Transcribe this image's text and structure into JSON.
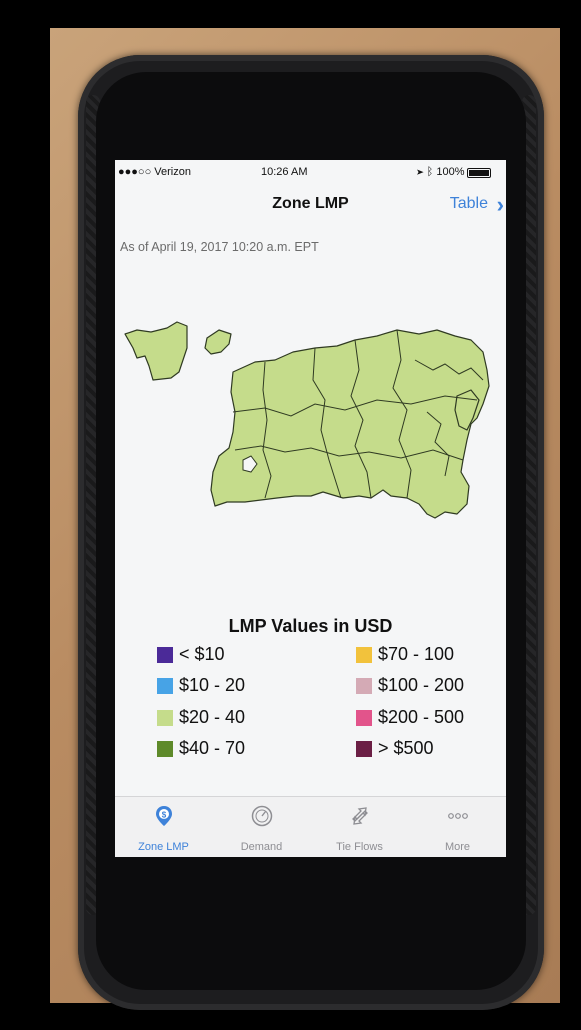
{
  "status_bar": {
    "carrier": "●●●○○ Verizon",
    "time": "10:26 AM",
    "battery": "100%"
  },
  "nav": {
    "title": "Zone LMP",
    "table_link": "Table"
  },
  "as_of": "As of April 19, 2017 10:20 a.m. EPT",
  "map": {
    "fill_color": "#c5dc8b"
  },
  "legend": {
    "title": "LMP Values in USD",
    "items": [
      {
        "label": "< $10",
        "color": "#4b2a98"
      },
      {
        "label": "$10 - 20",
        "color": "#47a3e6"
      },
      {
        "label": "$20 - 40",
        "color": "#c5dc8b"
      },
      {
        "label": "$40 - 70",
        "color": "#5e8a2a"
      },
      {
        "label": "$70 - 100",
        "color": "#f2c23c"
      },
      {
        "label": "$100 - 200",
        "color": "#d4aab5"
      },
      {
        "label": "$200 - 500",
        "color": "#e2548b"
      },
      {
        "label": "> $500",
        "color": "#6b1f45"
      }
    ]
  },
  "tabs": [
    {
      "label": "Zone LMP",
      "icon": "dollar-pin-icon",
      "active": true
    },
    {
      "label": "Demand",
      "icon": "gauge-icon",
      "active": false
    },
    {
      "label": "Tie Flows",
      "icon": "exchange-arrows-icon",
      "active": false
    },
    {
      "label": "More",
      "icon": "more-dots-icon",
      "active": false
    }
  ],
  "accent_color": "#3e82d9"
}
